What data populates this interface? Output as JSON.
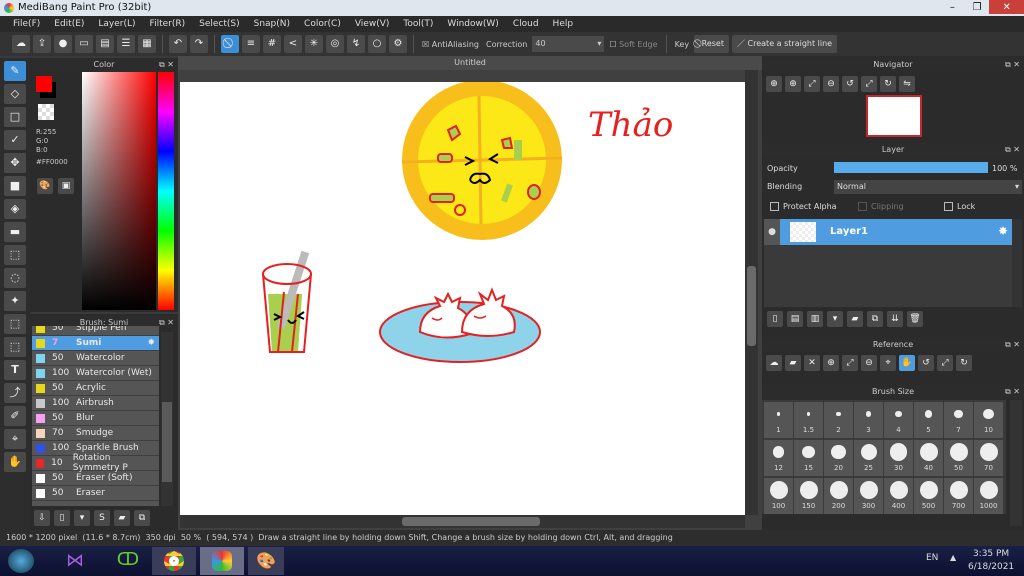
{
  "window": {
    "title": "MediBang Paint Pro (32bit)",
    "controls": [
      "minimize",
      "restore",
      "close"
    ]
  },
  "menu": [
    "File(F)",
    "Edit(E)",
    "Layer(L)",
    "Filter(R)",
    "Select(S)",
    "Snap(N)",
    "Color(C)",
    "View(V)",
    "Tool(T)",
    "Window(W)",
    "Cloud",
    "Help"
  ],
  "toolbar": {
    "antialiasing": "AntiAliasing",
    "correction_label": "Correction",
    "correction_value": "40",
    "soft_edge": "Soft Edge",
    "key": "Key",
    "reset": "Reset",
    "straight_line": "Create a straight line"
  },
  "color_panel": {
    "title": "Color",
    "r": "R:255",
    "g": "G:0",
    "b": "B:0",
    "hex": "#FF0000",
    "primary": "#FF0000",
    "secondary": "#000000"
  },
  "brush_panel": {
    "title": "Brush: Sumi",
    "items": [
      {
        "size": "50",
        "name": "Stipple Pen",
        "color": "#e8d81c"
      },
      {
        "size": "7",
        "name": "Sumi",
        "color": "#e8d81c",
        "selected": true
      },
      {
        "size": "50",
        "name": "Watercolor",
        "color": "#7fd4f0"
      },
      {
        "size": "100",
        "name": "Watercolor (Wet)",
        "color": "#7fd4f0"
      },
      {
        "size": "50",
        "name": "Acrylic",
        "color": "#e8d81c"
      },
      {
        "size": "100",
        "name": "Airbrush",
        "color": "#c8c8c8"
      },
      {
        "size": "50",
        "name": "Blur",
        "color": "#f5a0f0"
      },
      {
        "size": "70",
        "name": "Smudge",
        "color": "#f8d4bc"
      },
      {
        "size": "100",
        "name": "Sparkle Brush",
        "color": "#3050e8"
      },
      {
        "size": "10",
        "name": "Rotation Symmetry P",
        "color": "#e82828"
      },
      {
        "size": "50",
        "name": "Eraser (Soft)",
        "color": "#ffffff"
      },
      {
        "size": "50",
        "name": "Eraser",
        "color": "#ffffff"
      }
    ]
  },
  "canvas": {
    "tab": "Untitled",
    "signature": "Thảo"
  },
  "navigator": {
    "title": "Navigator"
  },
  "layer_panel": {
    "title": "Layer",
    "opacity_label": "Opacity",
    "opacity_value": "100 %",
    "opacity": 100,
    "blending_label": "Blending",
    "blending_value": "Normal",
    "protect_alpha": "Protect Alpha",
    "clipping": "Clipping",
    "lock": "Lock",
    "layers": [
      {
        "name": "Layer1",
        "selected": true
      }
    ]
  },
  "reference": {
    "title": "Reference"
  },
  "brush_size": {
    "title": "Brush Size",
    "sizes": [
      "1",
      "1.5",
      "2",
      "3",
      "4",
      "5",
      "7",
      "10",
      "12",
      "15",
      "20",
      "25",
      "30",
      "40",
      "50",
      "70",
      "100",
      "150",
      "200",
      "300",
      "400",
      "500",
      "700",
      "1000"
    ]
  },
  "status": {
    "dimensions": "1600 * 1200 pixel",
    "physical": "(11.6 * 8.7cm)",
    "dpi": "350 dpi",
    "zoom": "50 %",
    "coords": "( 594, 574 )",
    "hint": "Draw a straight line by holding down Shift, Change a brush size by holding down Ctrl, Alt, and dragging"
  },
  "taskbar": {
    "lang": "EN",
    "time": "3:35 PM",
    "date": "6/18/2021"
  }
}
